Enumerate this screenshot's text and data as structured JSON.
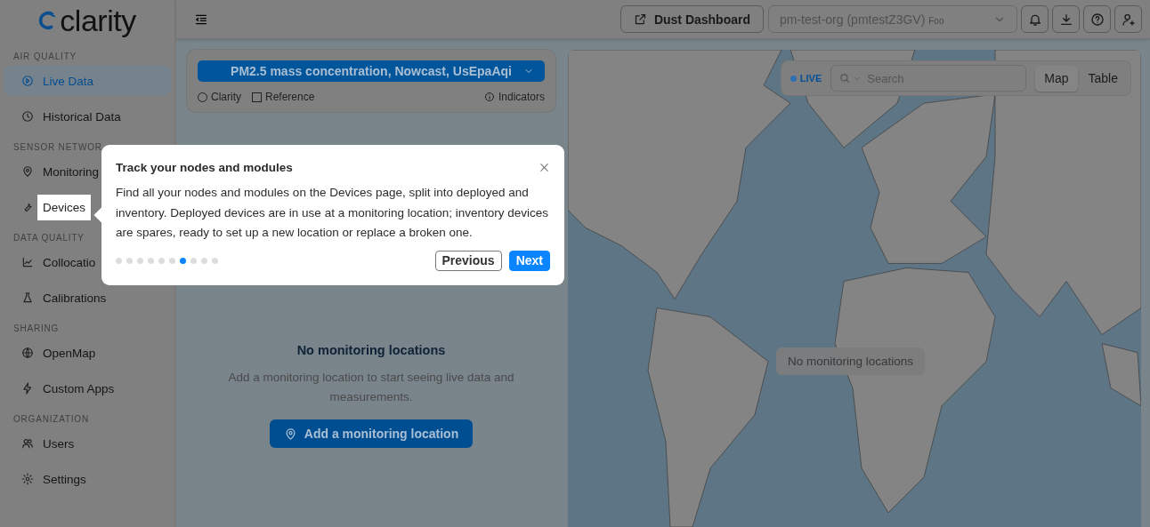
{
  "logo": {
    "text": "clarity"
  },
  "sidebar": {
    "sections": [
      {
        "heading": "AIR QUALITY",
        "items": [
          {
            "label": "Live Data",
            "selected": true,
            "highlighted": false
          },
          {
            "label": "Historical Data",
            "selected": false,
            "highlighted": false
          }
        ]
      },
      {
        "heading": "SENSOR NETWOR",
        "items": [
          {
            "label": "Monitoring",
            "selected": false,
            "highlighted": false
          },
          {
            "label": "Devices",
            "selected": false,
            "highlighted": true
          }
        ]
      },
      {
        "heading": "DATA QUALITY",
        "items": [
          {
            "label": "Collocatio",
            "selected": false,
            "highlighted": false
          },
          {
            "label": "Calibrations",
            "selected": false,
            "highlighted": false
          }
        ]
      },
      {
        "heading": "SHARING",
        "items": [
          {
            "label": "OpenMap",
            "selected": false,
            "highlighted": false
          },
          {
            "label": "Custom Apps",
            "selected": false,
            "highlighted": false
          }
        ]
      },
      {
        "heading": "ORGANIZATION",
        "items": [
          {
            "label": "Users",
            "selected": false,
            "highlighted": false
          },
          {
            "label": "Settings",
            "selected": false,
            "highlighted": false
          }
        ]
      }
    ]
  },
  "topbar": {
    "dashboard_button": "Dust Dashboard",
    "org_select": {
      "value": "pm-test-org (pmtestZ3GV)",
      "tag": "Foo"
    }
  },
  "filter": {
    "metric": "PM2.5 mass concentration, Nowcast, UsEpaAqi",
    "options": [
      {
        "kind": "radio",
        "label": "Clarity",
        "checked": false
      },
      {
        "kind": "checkbox",
        "label": "Reference",
        "checked": false
      }
    ],
    "indicators": "Indicators"
  },
  "empty_state": {
    "title": "No monitoring locations",
    "body": "Add a monitoring location to start seeing live data and measurements.",
    "button": "Add a monitoring location"
  },
  "map": {
    "live": "LIVE",
    "search": {
      "placeholder": "Search"
    },
    "views": [
      {
        "label": "Map",
        "selected": true
      },
      {
        "label": "Table",
        "selected": false
      }
    ],
    "badge": "No monitoring locations"
  },
  "tour": {
    "title": "Track your nodes and modules",
    "body": "Find all your nodes and modules on the Devices page, split into deployed and inventory. Deployed devices are in use at a monitoring location; inventory devices are spares, ready to set up a new location or replace a broken one.",
    "steps": [
      {
        "selected": false
      },
      {
        "selected": false
      },
      {
        "selected": false
      },
      {
        "selected": false
      },
      {
        "selected": false
      },
      {
        "selected": false
      },
      {
        "selected": true
      },
      {
        "selected": false
      },
      {
        "selected": false
      },
      {
        "selected": false
      }
    ],
    "previous": "Previous",
    "next": "Next"
  }
}
